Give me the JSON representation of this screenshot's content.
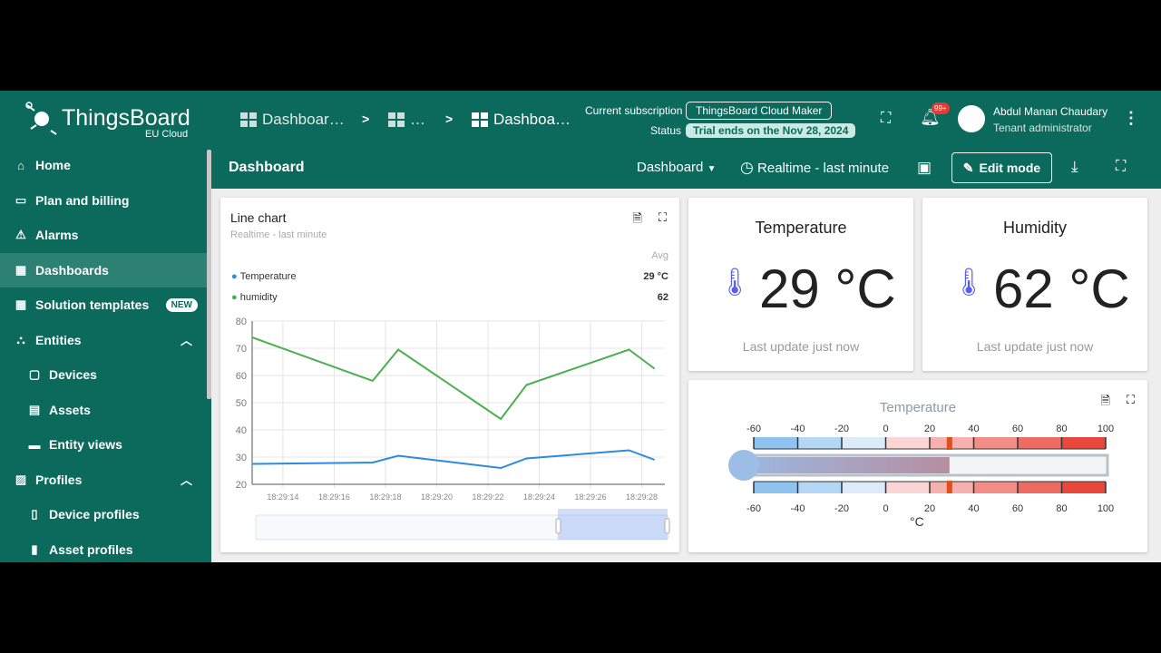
{
  "brand": {
    "name": "ThingsBoard",
    "region": "EU Cloud"
  },
  "breadcrumb": [
    "Dashboar…",
    "…",
    "Dashboa…"
  ],
  "subscription": {
    "label": "Current subscription",
    "plan": "ThingsBoard Cloud Maker",
    "status_label": "Status",
    "status": "Trial ends on the Nov 28, 2024"
  },
  "notifications": {
    "count": "99+"
  },
  "user": {
    "name": "Abdul Manan Chaudary",
    "role": "Tenant administrator"
  },
  "sidebar": {
    "items": [
      {
        "label": "Home",
        "icon": "home-icon"
      },
      {
        "label": "Plan and billing",
        "icon": "card-icon"
      },
      {
        "label": "Alarms",
        "icon": "warning-icon"
      },
      {
        "label": "Dashboards",
        "icon": "dashboard-icon",
        "selected": true
      },
      {
        "label": "Solution templates",
        "icon": "grid-icon",
        "badge": "NEW"
      },
      {
        "label": "Entities",
        "icon": "entities-icon",
        "expanded": true
      },
      {
        "label": "Devices",
        "icon": "device-icon"
      },
      {
        "label": "Assets",
        "icon": "asset-icon"
      },
      {
        "label": "Entity views",
        "icon": "view-icon"
      },
      {
        "label": "Profiles",
        "icon": "profiles-icon",
        "expanded": true
      },
      {
        "label": "Device profiles",
        "icon": "device-profile-icon"
      },
      {
        "label": "Asset profiles",
        "icon": "asset-profile-icon"
      }
    ]
  },
  "dashbar": {
    "title": "Dashboard",
    "state": "Dashboard",
    "timewindow": "Realtime - last minute",
    "edit": "Edit mode"
  },
  "linechart": {
    "title": "Line chart",
    "subtitle": "Realtime - last minute",
    "avg_header": "Avg",
    "legend": [
      {
        "name": "Temperature",
        "avg": "29 °C",
        "color": "#2a8be0"
      },
      {
        "name": "humidity",
        "avg": "62",
        "color": "#4caf50"
      }
    ]
  },
  "chart_data": {
    "type": "line",
    "title": "Line chart",
    "xlabel": "",
    "ylabel": "",
    "ylim": [
      20,
      80
    ],
    "xlim": [
      12.8,
      28.9
    ],
    "yticks": [
      "80",
      "70",
      "60",
      "50",
      "40",
      "30",
      "20"
    ],
    "xticks": [
      {
        "t": 14,
        "label": "18:29:14"
      },
      {
        "t": 16,
        "label": "18:29:16"
      },
      {
        "t": 18,
        "label": "18:29:18"
      },
      {
        "t": 20,
        "label": "18:29:20"
      },
      {
        "t": 22,
        "label": "18:29:22"
      },
      {
        "t": 24,
        "label": "18:29:24"
      },
      {
        "t": 26,
        "label": "18:29:26"
      },
      {
        "t": 28,
        "label": "18:29:28"
      }
    ],
    "x_unit": "seconds after 18:29:00",
    "grid": true,
    "series": [
      {
        "name": "Temperature",
        "color": "#2a8be0",
        "x": [
          12.8,
          17.5,
          18.5,
          22.5,
          23.5,
          27.5,
          28.5
        ],
        "y": [
          27.5,
          28,
          30.5,
          26,
          29.5,
          32.5,
          29
        ]
      },
      {
        "name": "humidity",
        "color": "#4caf50",
        "x": [
          12.8,
          17.5,
          18.5,
          22.5,
          23.5,
          27.5,
          28.5
        ],
        "y": [
          74,
          58,
          69.5,
          44,
          56.5,
          69.5,
          62.5
        ]
      }
    ]
  },
  "temp_card": {
    "title": "Temperature",
    "value": "29 °C",
    "update": "Last update just now"
  },
  "hum_card": {
    "title": "Humidity",
    "value": "62 °C",
    "update": "Last update just now"
  },
  "thermo": {
    "title": "Temperature",
    "unit": "°C",
    "min": -60,
    "max": 100,
    "value": 29,
    "ticks": [
      "-60",
      "-40",
      "-20",
      "0",
      "20",
      "40",
      "60",
      "80",
      "100"
    ],
    "band_colors": [
      "#8ec3f0",
      "#b3d7f5",
      "#dcebfa",
      "#fbd5d5",
      "#f6b0ad",
      "#f28d88",
      "#ee6b63",
      "#e8473c"
    ]
  }
}
